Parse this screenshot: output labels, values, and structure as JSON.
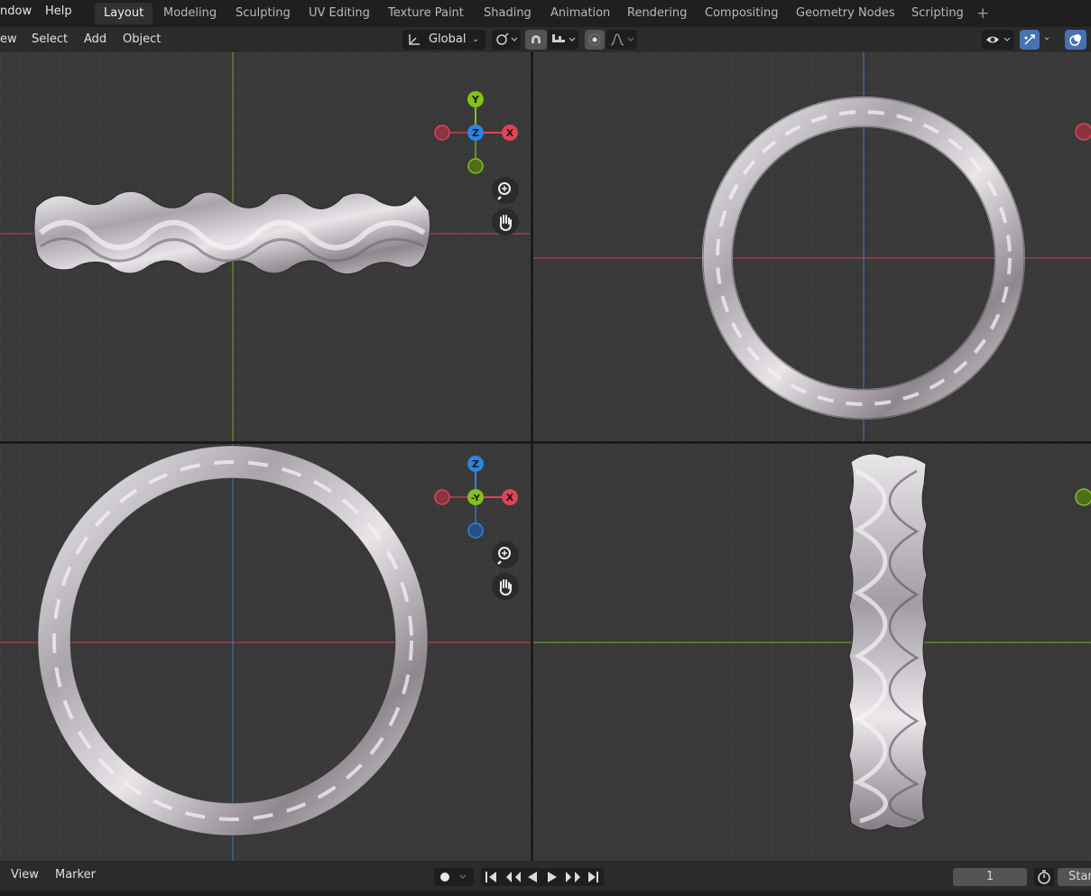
{
  "menubar": {
    "items": [
      "ndow",
      "Help"
    ]
  },
  "workspace_tabs": [
    {
      "label": "Layout",
      "active": true
    },
    {
      "label": "Modeling"
    },
    {
      "label": "Sculpting"
    },
    {
      "label": "UV Editing"
    },
    {
      "label": "Texture Paint"
    },
    {
      "label": "Shading"
    },
    {
      "label": "Animation"
    },
    {
      "label": "Rendering"
    },
    {
      "label": "Compositing"
    },
    {
      "label": "Geometry Nodes"
    },
    {
      "label": "Scripting"
    }
  ],
  "add_tab_icon": "+",
  "header": {
    "menus": [
      "ew",
      "Select",
      "Add",
      "Object"
    ],
    "transform_orientation": "Global"
  },
  "gizmo_top": {
    "y": "Y",
    "z": "Z",
    "x": "X"
  },
  "gizmo_front": {
    "z": "Z",
    "y": "-Y",
    "x": "X"
  },
  "timeline": {
    "menus": [
      "View",
      "Marker"
    ],
    "current_frame": "1",
    "start_label": "Star"
  },
  "colors": {
    "viewport_bg": "#393939",
    "grid_minor": "#444444",
    "grid_major": "#4d4d4d",
    "axis_x": "#b3404a",
    "axis_y": "#6a9a28",
    "axis_z": "#3b6db8",
    "gizmo_x": "#e04258",
    "gizmo_y": "#84c018",
    "gizmo_z": "#2a86e0",
    "accent_blue": "#4772b3"
  },
  "icons": {
    "transform_pivot": "transform-orientation-icon",
    "snap": "magnet-icon",
    "proportional": "proportional-edit-icon",
    "zoom": "zoom-icon",
    "pan": "hand-icon",
    "visibility": "eye-icon",
    "gizmo_toggle": "gizmo-icon",
    "overlay": "overlay-icon"
  }
}
